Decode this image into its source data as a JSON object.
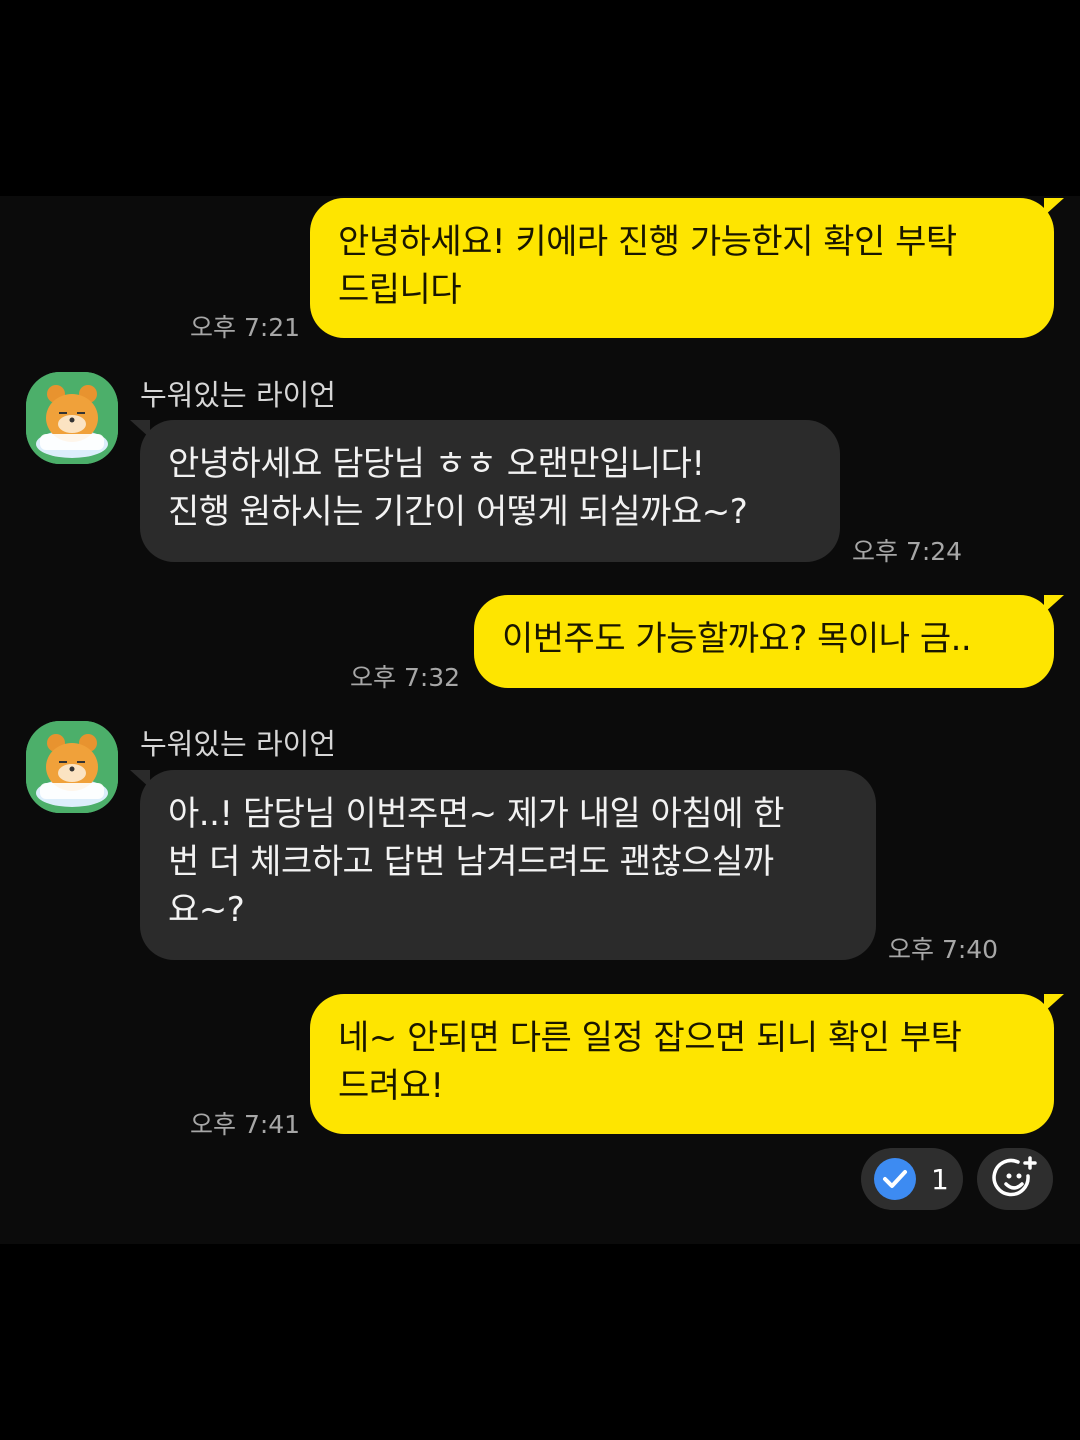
{
  "messages": [
    {
      "text": "안녕하세요! 키에라 진행 가능한지 확인 부탁\n드립니다",
      "time": "오후 7:21"
    },
    {
      "sender": "누워있는 라이언",
      "text": "안녕하세요 담당님 ㅎㅎ 오랜만입니다!\n진행 원하시는 기간이 어떻게 되실까요~?",
      "time": "오후 7:24"
    },
    {
      "text": "이번주도 가능할까요? 목이나 금..",
      "time": "오후 7:32"
    },
    {
      "sender": "누워있는 라이언",
      "text": "아..! 담당님 이번주면~ 제가 내일 아침에 한\n번 더 체크하고 답변 남겨드려도 괜찮으실까\n요~?",
      "time": "오후 7:40"
    },
    {
      "text": "네~ 안되면 다른 일정 잡으면 되니 확인 부탁\n드려요!",
      "time": "오후 7:41"
    }
  ],
  "reaction": {
    "count": "1",
    "check_color": "#3d8bf2"
  },
  "colors": {
    "outgoing": "#fee500",
    "incoming": "#2b2b2b",
    "background": "#0b0b0b"
  }
}
